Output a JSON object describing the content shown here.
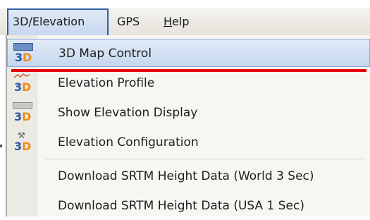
{
  "menubar": {
    "items": [
      {
        "label": "3D/Elevation"
      },
      {
        "label": "GPS"
      },
      {
        "label_rest": "elp",
        "label_ul": "H"
      }
    ]
  },
  "dropdown": {
    "items": [
      {
        "label": "3D Map Control",
        "icon": "3d-map-control-icon",
        "highlighted": true
      },
      {
        "label": "Elevation Profile",
        "icon": "elevation-profile-icon"
      },
      {
        "label": "Show Elevation Display",
        "icon": "elevation-display-icon"
      },
      {
        "label": "Elevation Configuration",
        "icon": "elevation-config-icon"
      },
      {
        "label": "Download SRTM Height Data (World 3 Sec)"
      },
      {
        "label": "Download SRTM Height Data (USA 1 Sec)"
      }
    ],
    "icon_text": {
      "three": "3",
      "d": "D"
    }
  },
  "colors": {
    "highlight": "#c5d6ef",
    "annotation_underline": "#e8000c",
    "icon_blue": "#2c56a8",
    "icon_orange": "#f08a1a"
  }
}
